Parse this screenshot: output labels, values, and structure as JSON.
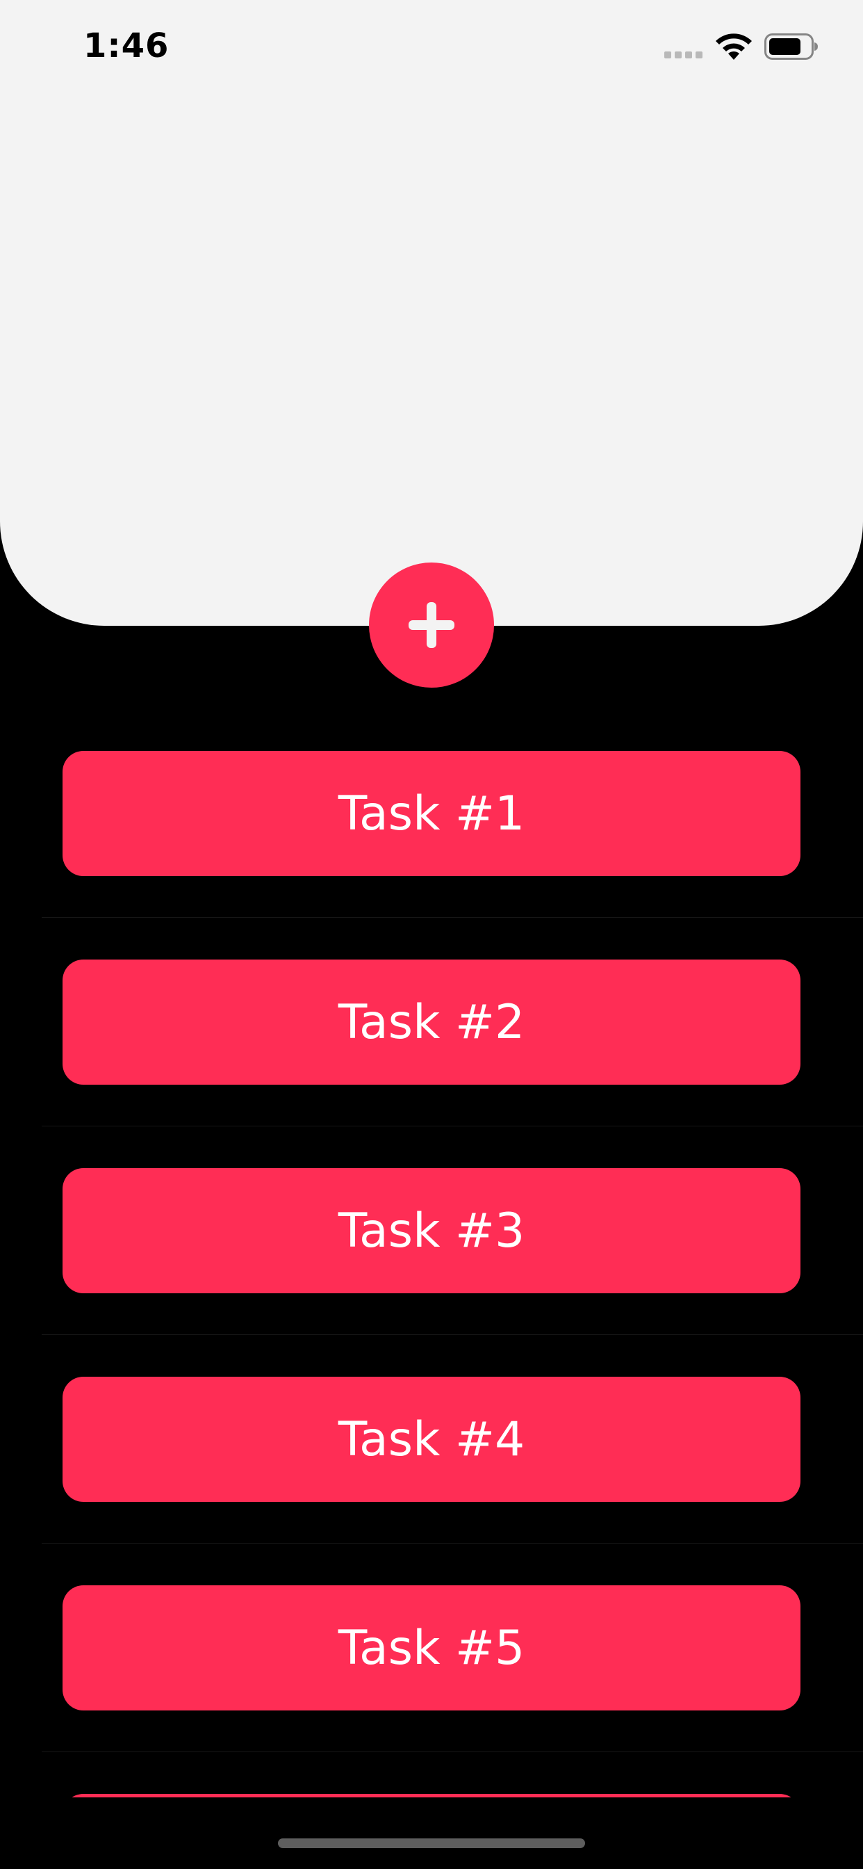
{
  "status_bar": {
    "time": "1:46",
    "icons": [
      "signal-icon",
      "wifi-icon",
      "battery-icon"
    ]
  },
  "add_button": {
    "icon": "plus-icon"
  },
  "tasks": [
    {
      "label": "Task #1"
    },
    {
      "label": "Task #2"
    },
    {
      "label": "Task #3"
    },
    {
      "label": "Task #4"
    },
    {
      "label": "Task #5"
    },
    {
      "label": ""
    }
  ],
  "colors": {
    "accent": "#ff2d55",
    "card_background": "#f3f3f3",
    "page_background": "#000000"
  }
}
